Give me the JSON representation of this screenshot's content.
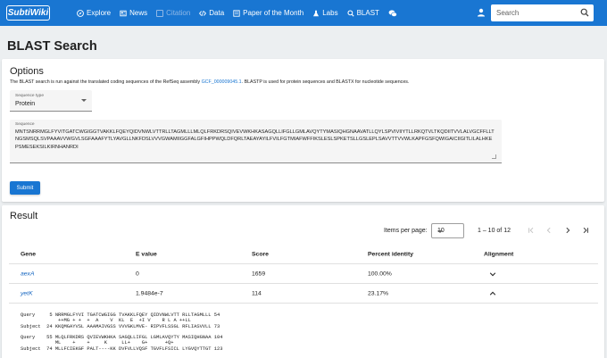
{
  "nav": {
    "logo": "SubtiWiki",
    "items": [
      {
        "label": "Explore",
        "icon": "compass-icon"
      },
      {
        "label": "News",
        "icon": "news-icon"
      },
      {
        "label": "Citation",
        "icon": "citation-icon"
      },
      {
        "label": "Data",
        "icon": "code-icon"
      },
      {
        "label": "Paper of the Month",
        "icon": "paper-icon"
      },
      {
        "label": "Labs",
        "icon": "flask-icon"
      },
      {
        "label": "BLAST",
        "icon": "search-icon"
      }
    ],
    "search_placeholder": "Search"
  },
  "page_title": "BLAST Search",
  "options": {
    "title": "Options",
    "desc_before": "The BLAST search is run against the translated coding sequences of the RefSeq assembly ",
    "desc_link": "GCF_000009045.1",
    "desc_after": ". BLASTP is used for protein sequences and BLASTX for nucleotide sequences.",
    "seq_type_label": "Sequence type",
    "seq_type_value": "Protein",
    "sequence_label": "Sequence",
    "sequence_value": "MNTSNRRMGLFYVITGATCWGIGGTVAKKLFQEYQIDVNWLVTTRLLTAGMLLLMLQLFRKDRSQIVEVWKHKASAGQLLIFGLLGMLAVQYTYMASIQHGNAAVATLLQYLSPVIVIIYTLLRKQTVLTKQDIITVVLALVGCFFLLTNGSMSQLSVPAAAVVWGVLSGFAAAFYTLYAVGLLNKFDSLVVVGWAMIIGGFALGFIHPPWQLDFQRLTAEAYAYILFVILFGTMIAFWFFIKSLESLSPKETSLLGSLEPLSAVVTTVVWLKAPFGSFQWIGAICIIGITLILALHKEPSMESEKSILKIRNHANRDI",
    "submit_label": "Submit"
  },
  "result": {
    "title": "Result",
    "items_per_page_label": "Items per page:",
    "items_per_page_value": "10",
    "range": "1 – 10 of 12",
    "columns": [
      "Gene",
      "E value",
      "Score",
      "Percent identity",
      "Alignment"
    ],
    "rows": [
      {
        "gene": "aexA",
        "evalue": "0",
        "score": "1659",
        "identity": "100.00%"
      },
      {
        "gene": "yetK",
        "evalue": "1.9484e-7",
        "score": "114",
        "identity": "23.17%"
      }
    ],
    "alignment_text": "Query     5 NRRMGLFYVI TGATCWGIGG TVAKKLFQEY QIDVNWLVTT RLLTAGMLLL 54\n             ++MG + +  +  A    V  KL  E  +I V    R L A ++LL\nSubject  24 KKQMGAYVSL AAAMAIVGSS VVVGKLMVE- RIPVFLSSGL RFLIASVVLL 73\n\nQuery    55 MLQLFRKDRS QVIEVWKHKA SAGQLLIFGL LGMLAVQYTY MASIQHGNAA 104\n            ML    +    +     K     LL+    G+      +Q+\nSubject  74 MLLFCIEKGF PALT----KK DVFVLLVQSF TGVFLFSICL LYGVQYTTGT 123"
  }
}
